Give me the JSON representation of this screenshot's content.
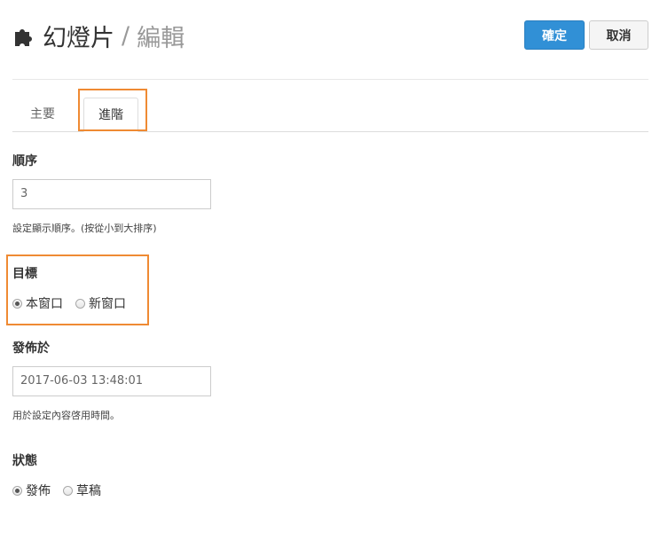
{
  "header": {
    "icon": "puzzle-piece-icon",
    "title": "幻燈片",
    "separator": "/",
    "subtitle": "編輯"
  },
  "toolbar": {
    "confirm_label": "確定",
    "cancel_label": "取消",
    "confirm_color": "#3190d6"
  },
  "tabs": [
    {
      "label": "主要",
      "active": false
    },
    {
      "label": "進階",
      "active": true
    }
  ],
  "highlight_color": "#ef8a33",
  "fields": {
    "order": {
      "label": "順序",
      "value": "3",
      "help": "設定顯示順序。(按從小到大排序)"
    },
    "target": {
      "label": "目標",
      "options": [
        {
          "label": "本窗口",
          "checked": true
        },
        {
          "label": "新窗口",
          "checked": false
        }
      ]
    },
    "publish_at": {
      "label": "發佈於",
      "value": "2017-06-03 13:48:01",
      "help": "用於設定內容啓用時間。"
    },
    "status": {
      "label": "狀態",
      "options": [
        {
          "label": "發佈",
          "checked": true
        },
        {
          "label": "草稿",
          "checked": false
        }
      ]
    }
  }
}
